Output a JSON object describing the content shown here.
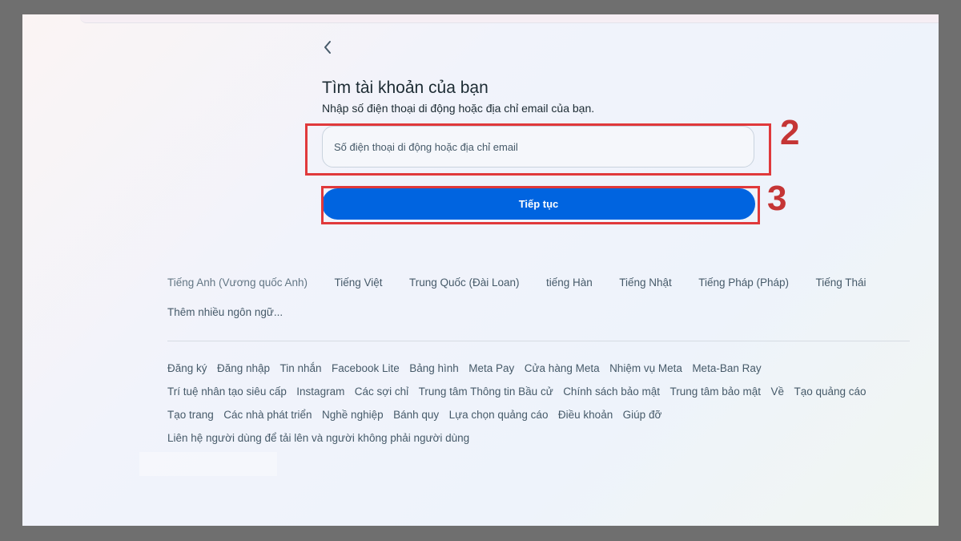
{
  "page": {
    "title": "Tìm tài khoản của bạn",
    "subtitle": "Nhập số điện thoại di động hoặc địa chỉ email của bạn."
  },
  "form": {
    "contact_placeholder": "Số điện thoại di động hoặc địa chỉ email",
    "contact_value": "",
    "continue_label": "Tiếp tục"
  },
  "annotations": {
    "input_step": "2",
    "button_step": "3"
  },
  "languages": {
    "items": [
      "Tiếng Anh (Vương quốc Anh)",
      "Tiếng Việt",
      "Trung Quốc (Đài Loan)",
      "tiếng Hàn",
      "Tiếng Nhật",
      "Tiếng Pháp (Pháp)",
      "Tiếng Thái"
    ],
    "more_label": "Thêm nhiều ngôn ngữ..."
  },
  "footer": {
    "rows": [
      [
        "Đăng ký",
        "Đăng nhập",
        "Tin nhắn",
        "Facebook Lite",
        "Bảng hình",
        "Meta Pay",
        "Cửa hàng Meta",
        "Nhiệm vụ Meta",
        "Meta-Ban Ray"
      ],
      [
        "Trí tuệ nhân tạo siêu cấp",
        "Instagram",
        "Các sợi chỉ",
        "Trung tâm Thông tin Bầu cử",
        "Chính sách bảo mật",
        "Trung tâm bảo mật",
        "Về",
        "Tạo quảng cáo"
      ],
      [
        "Tạo trang",
        "Các nhà phát triển",
        "Nghề nghiệp",
        "Bánh quy",
        "Lựa chọn quảng cáo",
        "Điều khoản",
        "Giúp đỡ"
      ],
      [
        "Liên hệ người dùng để tải lên và người không phải người dùng"
      ]
    ]
  },
  "colors": {
    "primary_button": "#0064e0",
    "annotation_red": "#e0393b",
    "text_primary": "#1c2b33",
    "text_secondary": "#465a69"
  },
  "icons": {
    "back": "chevron-left-icon"
  }
}
